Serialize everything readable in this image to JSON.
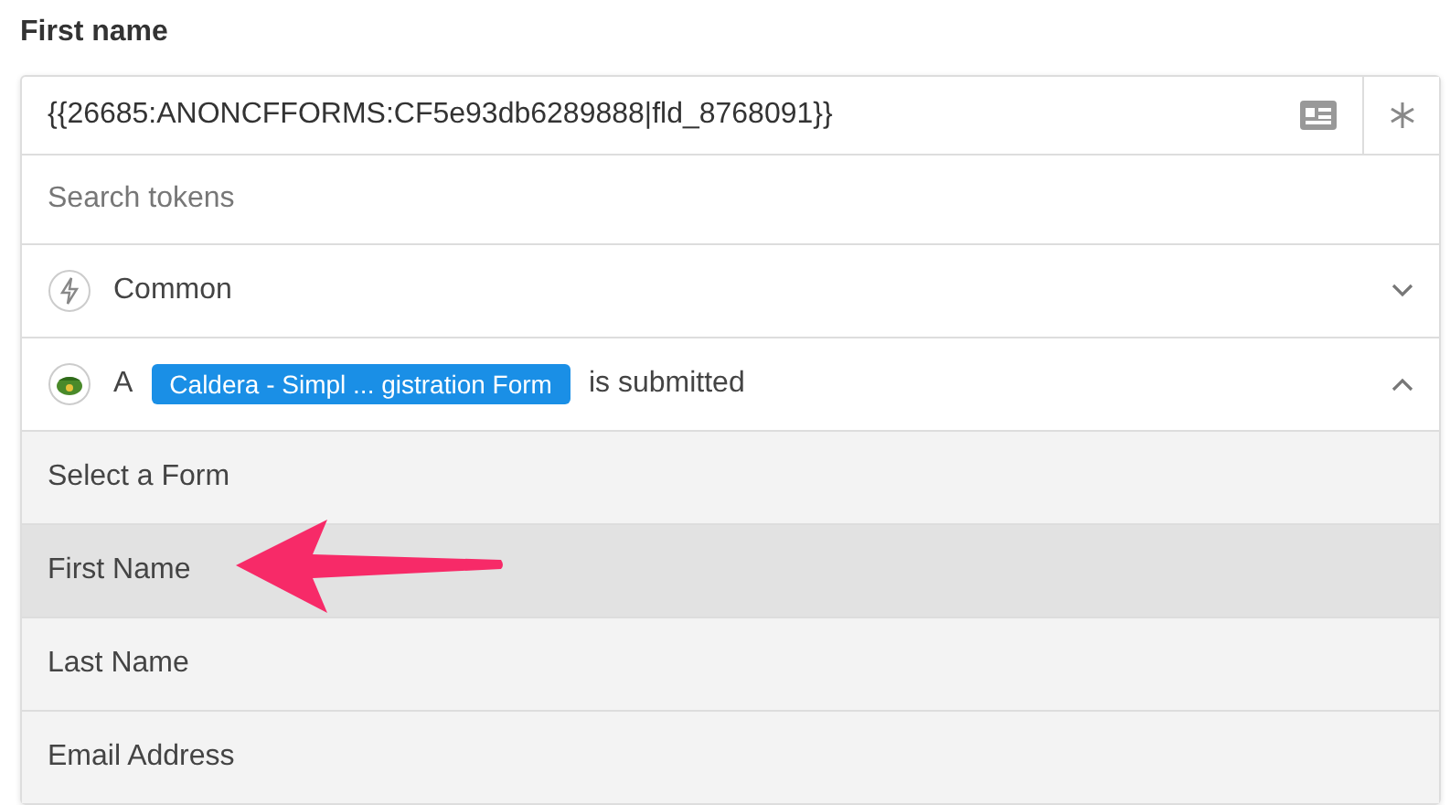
{
  "field": {
    "label": "First name",
    "value": "{{26685:ANONCFFORMS:CF5e93db6289888|fld_8768091}}"
  },
  "search": {
    "placeholder": "Search tokens"
  },
  "groups": [
    {
      "kind": "common",
      "label": "Common",
      "expanded": false
    },
    {
      "kind": "trigger",
      "prefix": "A",
      "tag": "Caldera - Simpl ... gistration Form",
      "suffix": "is submitted",
      "expanded": true,
      "items": [
        {
          "label": "Select a Form",
          "selected": false
        },
        {
          "label": "First Name",
          "selected": true
        },
        {
          "label": "Last Name",
          "selected": false
        },
        {
          "label": "Email Address",
          "selected": false
        }
      ]
    }
  ]
}
